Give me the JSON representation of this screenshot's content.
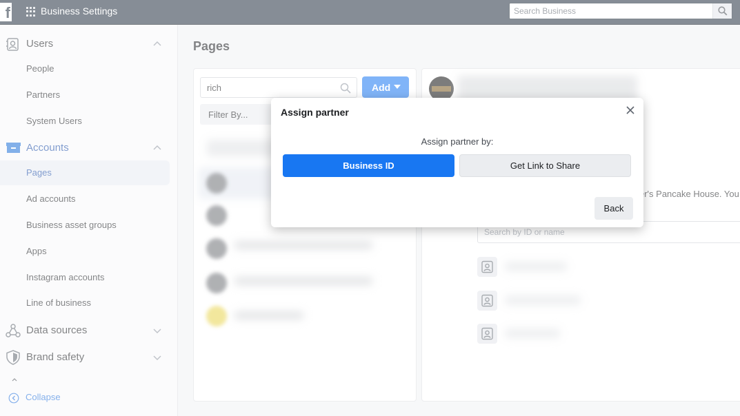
{
  "topbar": {
    "logo": "f",
    "app_title": "Business Settings",
    "search_placeholder": "Search Business"
  },
  "sidebar": {
    "users_section": {
      "label": "Users",
      "items": [
        "People",
        "Partners",
        "System Users"
      ]
    },
    "accounts_section": {
      "label": "Accounts",
      "items": [
        "Pages",
        "Ad accounts",
        "Business asset groups",
        "Apps",
        "Instagram accounts",
        "Line of business"
      ],
      "active": "Pages"
    },
    "data_sources_label": "Data sources",
    "brand_safety_label": "Brand safety",
    "collapse_label": "Collapse"
  },
  "main": {
    "page_title": "Pages",
    "search_value": "rich",
    "add_label": "Add",
    "filter_label": "Filter By...",
    "detail_partial_text": "er's Pancake House. You c",
    "people_search_placeholder": "Search by ID or name"
  },
  "modal": {
    "title": "Assign partner",
    "prompt": "Assign partner by:",
    "option_primary": "Business ID",
    "option_secondary": "Get Link to Share",
    "back_label": "Back"
  },
  "colors": {
    "topbar": "#233140",
    "primary_blue": "#1877f2",
    "accounts_blue": "#1d4ea8",
    "link_blue": "#216fdb"
  }
}
